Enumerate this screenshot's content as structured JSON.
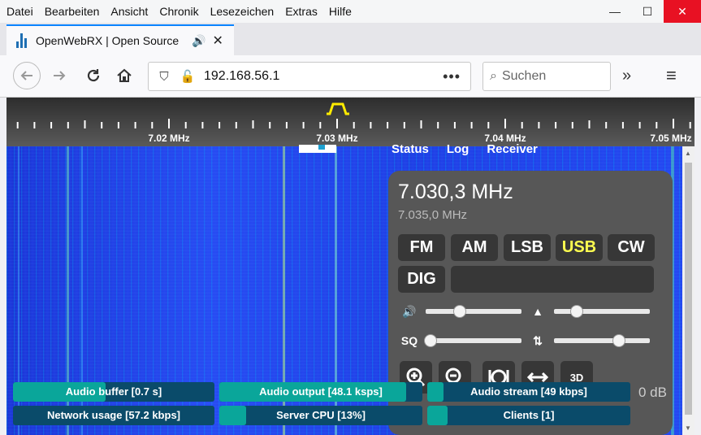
{
  "menubar": [
    "Datei",
    "Bearbeiten",
    "Ansicht",
    "Chronik",
    "Lesezeichen",
    "Extras",
    "Hilfe"
  ],
  "window_controls": {
    "minimize": "—",
    "maximize": "☐",
    "close": "✕"
  },
  "tab": {
    "title": "OpenWebRX | Open Source",
    "close": "✕",
    "speaker_icon": "speaker-icon"
  },
  "new_tab": "+",
  "nav": {
    "back_icon": "arrow-left-icon",
    "forward_icon": "arrow-right-icon",
    "reload_icon": "reload-icon",
    "home_icon": "home-icon",
    "overflow": "»",
    "menu": "≡"
  },
  "url": {
    "value": "192.168.56.1",
    "dots": "•••"
  },
  "search": {
    "placeholder": "Suchen"
  },
  "scale": {
    "ticks": [
      "7.02 MHz",
      "7.03 MHz",
      "7.04 MHz",
      "7.05 MHz"
    ]
  },
  "topnav": [
    "Status",
    "Log",
    "Receiver"
  ],
  "receiver": {
    "frequency": "7.030,3 MHz",
    "frequency_secondary": "7.035,0 MHz",
    "modes": [
      "FM",
      "AM",
      "LSB",
      "USB",
      "CW"
    ],
    "active_mode": "USB",
    "dig_label": "DIG",
    "sliders": {
      "volume": 0.36,
      "squelch": 0.05,
      "waterfall_high": 0.24,
      "waterfall_low": 0.68
    },
    "sq_label": "SQ",
    "db_text": "0 dB"
  },
  "meters": [
    {
      "label": "Audio buffer [0.7 s]",
      "level": 0.46
    },
    {
      "label": "Audio output [48.1 ksps]",
      "level": 0.92
    },
    {
      "label": "Audio stream [49 kbps]",
      "level": 0.08
    },
    {
      "label": "Network usage [57.2 kbps]",
      "level": 0.0
    },
    {
      "label": "Server CPU [13%]",
      "level": 0.13
    },
    {
      "label": "Clients [1]",
      "level": 0.1
    }
  ],
  "colors": {
    "accent": "#0a84ff",
    "active_mode": "#ffff50",
    "panel": "#575757",
    "meter_fill": "#0aa69a",
    "meter_bg": "#0a4b6a",
    "waterfall": "#1e3ae0"
  }
}
